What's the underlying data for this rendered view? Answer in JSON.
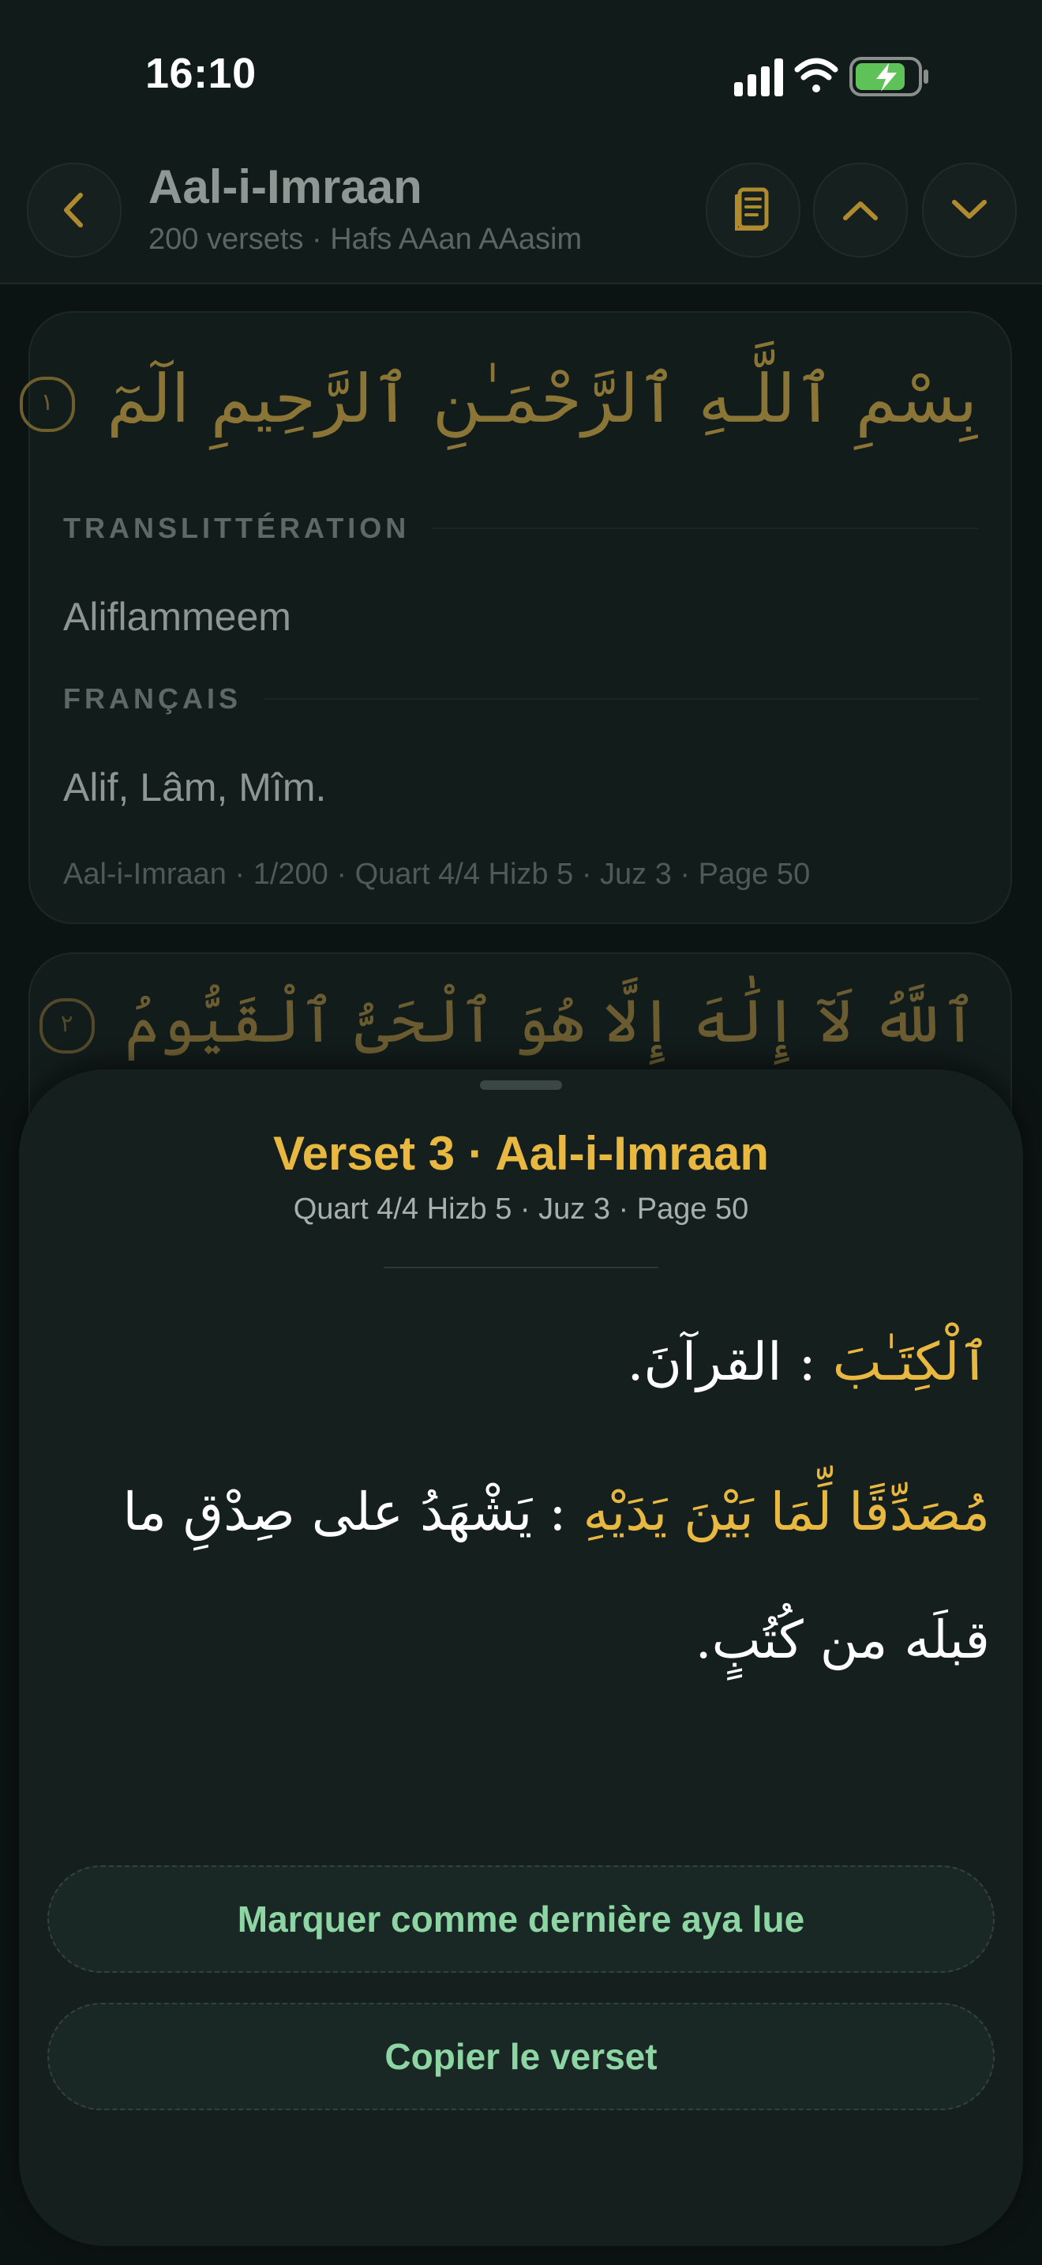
{
  "status_bar": {
    "time": "16:10",
    "icons": [
      "signal-icon",
      "wifi-icon",
      "battery-charging-icon"
    ]
  },
  "header": {
    "back_icon": "chevron-left-icon",
    "title": "Aal-i-Imraan",
    "subtitle": "200 versets · Hafs AAan AAasim",
    "buttons": [
      "book-icon",
      "chevron-up-icon",
      "chevron-down-icon"
    ]
  },
  "verse_cards": [
    {
      "arabic": "بِسْمِ ٱللَّـهِ ٱلرَّحْمَـٰنِ ٱلرَّحِيمِ الٓمٓ",
      "ayah_number": "١",
      "transliteration_label": "TRANSLITTÉRATION",
      "transliteration": "Aliflammeem",
      "french_label": "FRANÇAIS",
      "french": "Alif, Lâm, Mîm.",
      "meta": "Aal-i-Imraan · 1/200 · Quart 4/4 Hizb 5 · Juz 3 · Page 50"
    },
    {
      "arabic": "ٱللَّهُ لَآ إِلَٰهَ إِلَّا هُوَ ٱلْحَىُّ ٱلْقَيُّومُ",
      "ayah_number": "٢"
    }
  ],
  "sheet": {
    "title": "Verset 3 · Aal-i-Imraan",
    "subtitle": "Quart 4/4 Hizb 5 · Juz 3 · Page 50",
    "word_notes": [
      {
        "word": "ٱلْكِتَـٰبَ",
        "separator": " : ",
        "meaning": "القرآنَ."
      },
      {
        "word": "مُصَدِّقًا لِّمَا بَيْنَ يَدَيْهِ",
        "separator": " : ",
        "meaning": "يَشْهَدُ على صِدْقِ ما قبلَه من كُتُبٍ."
      }
    ],
    "actions": {
      "mark_last_read": "Marquer comme dernière aya lue",
      "copy_verse": "Copier le verset"
    }
  },
  "colors": {
    "background": "#0c1413",
    "accent_gold": "#e8b841",
    "accent_green": "#8ed5a4",
    "sheet": "#15201e"
  }
}
